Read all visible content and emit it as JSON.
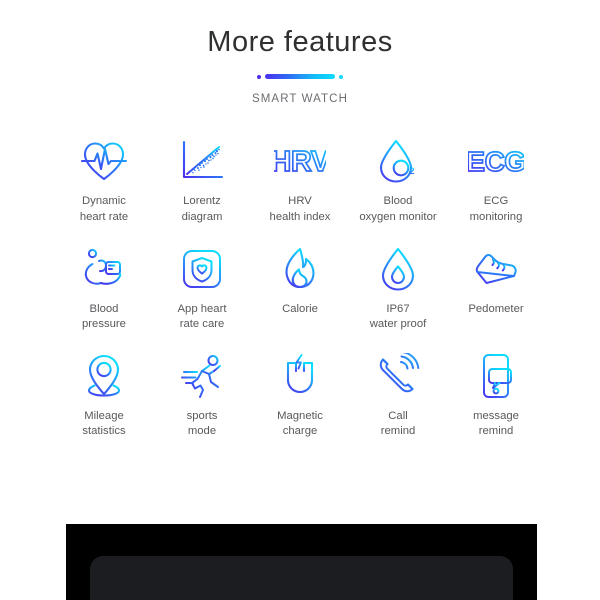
{
  "header": {
    "title": "More features",
    "subtitle": "SMART WATCH",
    "divider": {
      "left_dot": "dot",
      "right_dot": "dot",
      "gradient_start": "#4b2ff0",
      "gradient_end": "#0ddcff"
    }
  },
  "theme": {
    "accent_start": "#4b2ff0",
    "accent_end": "#0ddcff",
    "title_color": "#2f3032",
    "label_color": "#58595c",
    "background": "#ffffff",
    "panel_black": "#000000",
    "panel_screen": "#1b1d21"
  },
  "features": {
    "rows": [
      {
        "cells": [
          {
            "icon": "heartbeat-icon",
            "label": "Dynamic\nheart rate"
          },
          {
            "icon": "scatter-plot-icon",
            "label": "Lorentz\ndiagram"
          },
          {
            "icon": "hrv-text-icon",
            "label": "HRV\nhealth index",
            "icon_text": "HRV"
          },
          {
            "icon": "water-drop-o2-icon",
            "label": "Blood\noxygen monitor",
            "icon_text": "O"
          },
          {
            "icon": "ecg-text-icon",
            "label": "ECG\nmonitoring",
            "icon_text": "ECG"
          }
        ]
      },
      {
        "cells": [
          {
            "icon": "blood-pressure-cuff-icon",
            "label": "Blood\npressure"
          },
          {
            "icon": "shield-heart-app-icon",
            "label": "App heart\nrate care"
          },
          {
            "icon": "flame-icon",
            "label": "Calorie"
          },
          {
            "icon": "water-drop-icon",
            "label": "IP67\nwater proof"
          },
          {
            "icon": "sneaker-icon",
            "label": "Pedometer"
          }
        ]
      },
      {
        "cells": [
          {
            "icon": "map-pin-icon",
            "label": "Mileage\nstatistics"
          },
          {
            "icon": "running-person-icon",
            "label": "sports\nmode"
          },
          {
            "icon": "magnet-icon",
            "label": "Magnetic\ncharge"
          },
          {
            "icon": "phone-ring-icon",
            "label": "Call\nremind"
          },
          {
            "icon": "phone-message-icon",
            "label": "message\nremind"
          }
        ]
      }
    ]
  },
  "device_panel": {
    "name": "device-preview-panel"
  }
}
